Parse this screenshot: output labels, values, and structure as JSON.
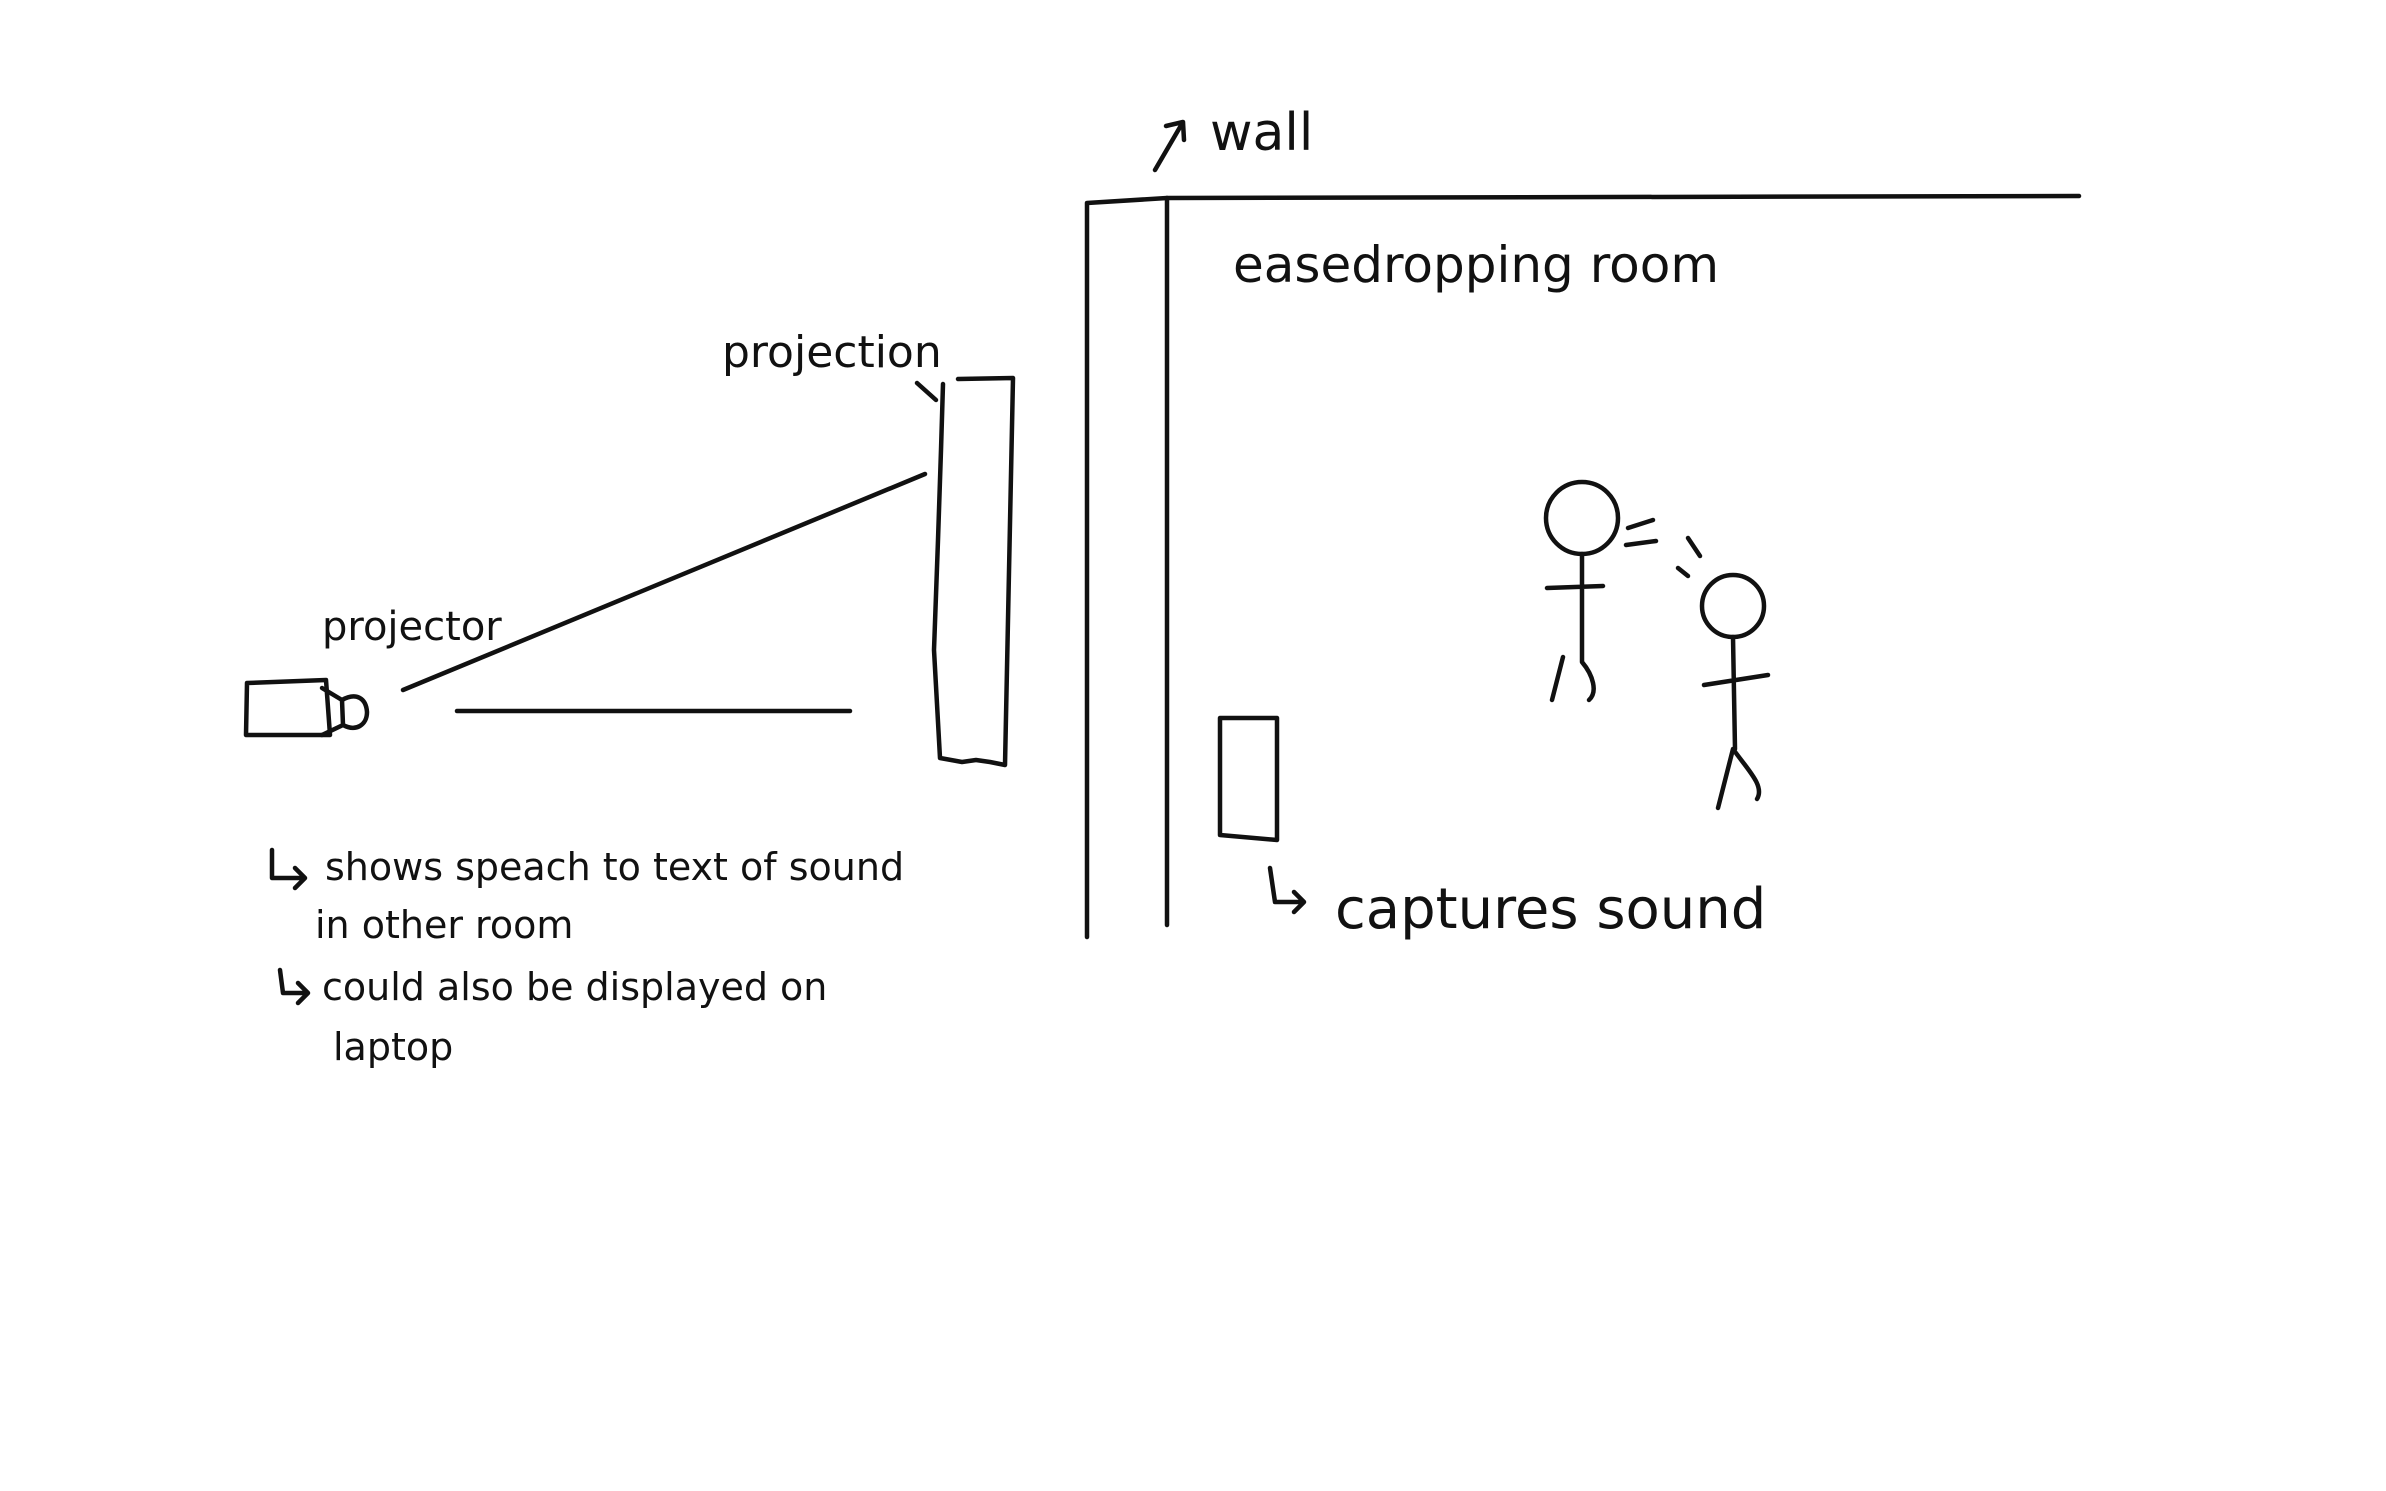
{
  "diagram": {
    "wall_label": "wall",
    "room_label": "easedropping room",
    "projection_label": "projection",
    "projector_label": "projector",
    "captures_label": "captures sound",
    "notes": [
      "shows speach to text of sound",
      "in other room",
      "could also be displayed on",
      "laptop"
    ]
  }
}
